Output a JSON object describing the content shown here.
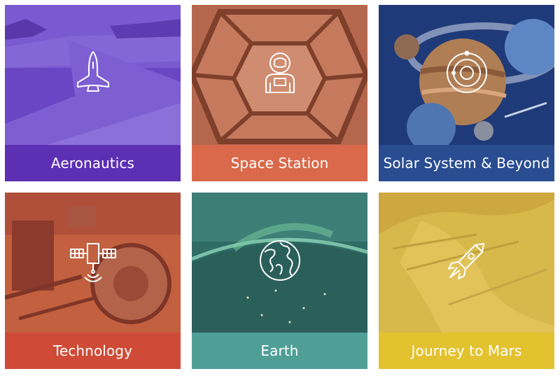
{
  "tiles": [
    {
      "label": "Aeronautics",
      "icon": "space-shuttle-icon",
      "color": "#5c2fb3"
    },
    {
      "label": "Space Station",
      "icon": "astronaut-icon",
      "color": "#d9694a"
    },
    {
      "label": "Solar System & Beyond",
      "icon": "orbit-icon",
      "color": "#2a4d92"
    },
    {
      "label": "Technology",
      "icon": "satellite-icon",
      "color": "#cf4b37"
    },
    {
      "label": "Earth",
      "icon": "globe-icon",
      "color": "#4f9f97"
    },
    {
      "label": "Journey to Mars",
      "icon": "rocket-icon",
      "color": "#e3c22f"
    }
  ]
}
